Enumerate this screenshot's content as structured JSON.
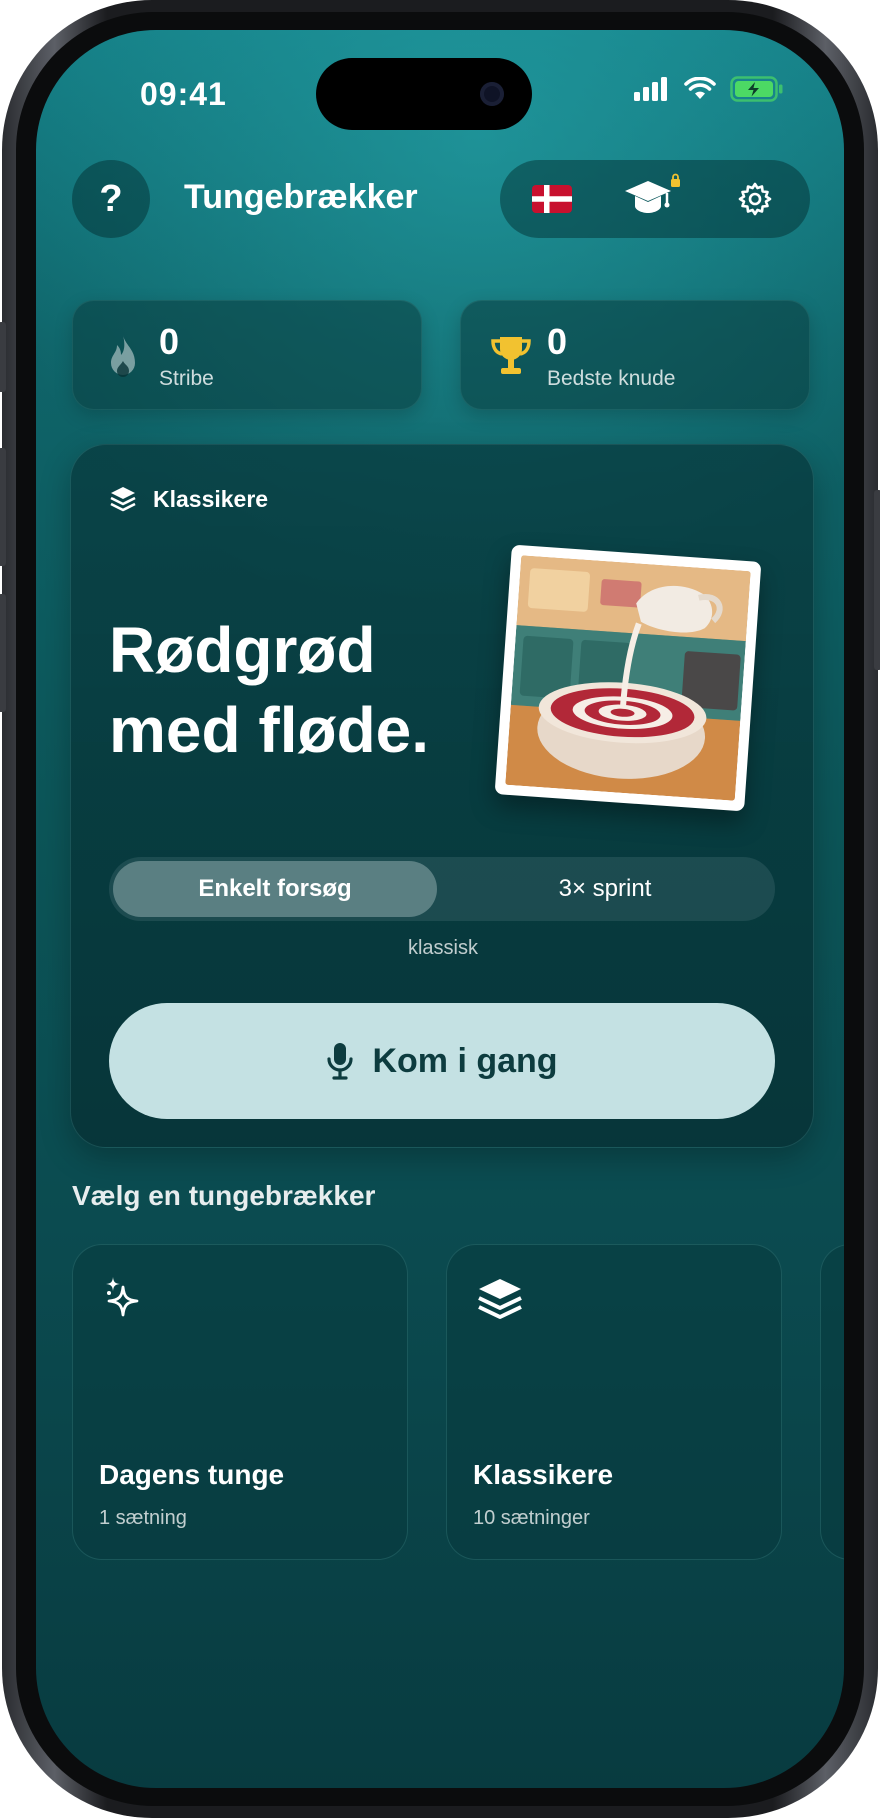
{
  "status_bar": {
    "time": "09:41"
  },
  "header": {
    "help_label": "?",
    "title": "Tungebrækker",
    "flag": "danish-flag-icon",
    "icons": [
      "graduation-cap-icon",
      "lock-icon",
      "gear-icon"
    ]
  },
  "stats": [
    {
      "value": "0",
      "label": "Stribe",
      "icon": "flame-icon"
    },
    {
      "value": "0",
      "label": "Bedste knude",
      "icon": "trophy-icon"
    }
  ],
  "featured": {
    "category": "Klassikere",
    "headline_line1": "Rødgrød",
    "headline_line2": "med fløde.",
    "modes": {
      "active": "Enkelt forsøg",
      "inactive": "3× sprint"
    },
    "mode_caption": "klassisk",
    "start_label": "Kom i gang"
  },
  "section_title": "Vælg en tungebrækker",
  "packs": [
    {
      "title": "Dagens tunge",
      "subtitle": "1 sætning",
      "icon": "sparkles-icon"
    },
    {
      "title": "Klassikere",
      "subtitle": "10 sætninger",
      "icon": "layers-icon"
    }
  ],
  "colors": {
    "background_top": "#147d84",
    "background_bottom": "#083b40",
    "start_button": "#c4e1e3",
    "start_button_text": "#0d3c3f",
    "trophy": "#f2c230",
    "battery": "#4cd964"
  }
}
